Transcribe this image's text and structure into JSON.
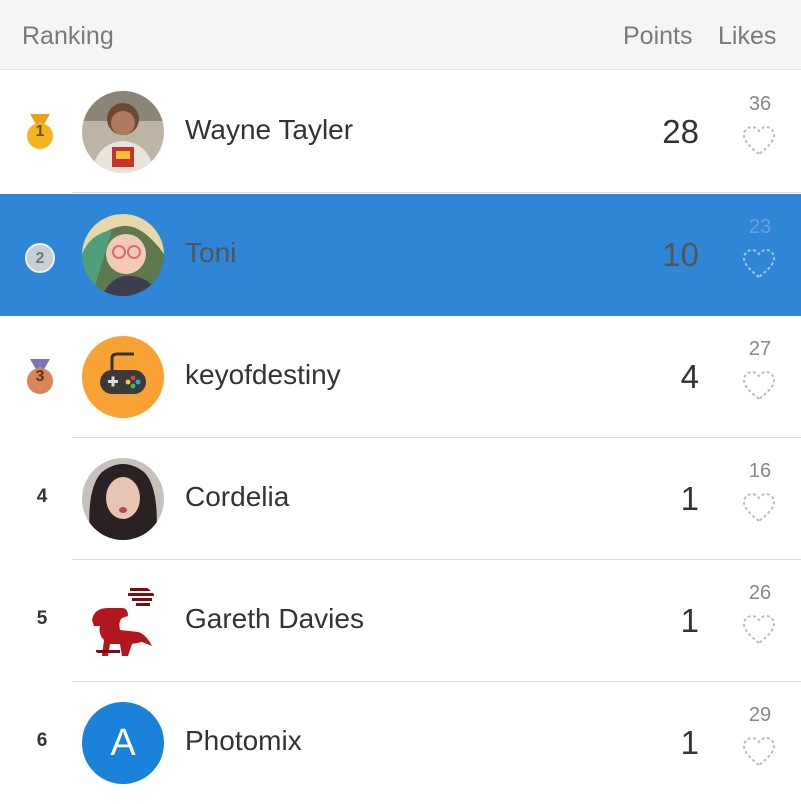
{
  "header": {
    "ranking": "Ranking",
    "points": "Points",
    "likes": "Likes"
  },
  "rows": [
    {
      "rank": "1",
      "name": "Wayne Tayler",
      "points": "28",
      "likes": "36",
      "badge": "gold-medal",
      "avatar": "photo"
    },
    {
      "rank": "2",
      "name": "Toni",
      "points": "10",
      "likes": "23",
      "badge": "silver-medal",
      "avatar": "photo",
      "selected": true
    },
    {
      "rank": "3",
      "name": "keyofdestiny",
      "points": "4",
      "likes": "27",
      "badge": "bronze-medal",
      "avatar": "gamepad"
    },
    {
      "rank": "4",
      "name": "Cordelia",
      "points": "1",
      "likes": "16",
      "badge": "none",
      "avatar": "photo"
    },
    {
      "rank": "5",
      "name": "Gareth Davies",
      "points": "1",
      "likes": "26",
      "badge": "none",
      "avatar": "dinosaur"
    },
    {
      "rank": "6",
      "name": "Photomix",
      "points": "1",
      "likes": "29",
      "badge": "none",
      "avatar": "letter",
      "avatar_letter": "A"
    }
  ],
  "colors": {
    "selected_row": "#2f86d6",
    "gold": "#f2b51e",
    "silver": "#c9ced4",
    "bronze": "#d9855a",
    "letter_avatar": "#1a82d8",
    "gamepad_bg": "#f7a233"
  }
}
